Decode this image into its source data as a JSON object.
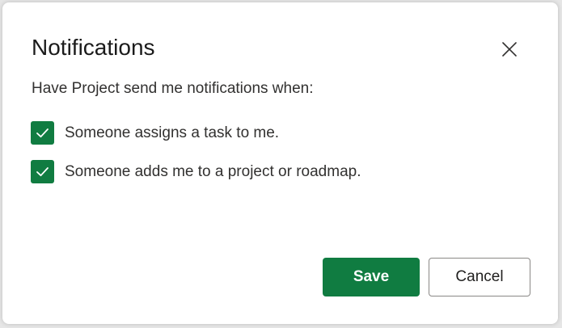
{
  "dialog": {
    "title": "Notifications",
    "subtitle": "Have Project send me notifications when:",
    "options": [
      {
        "label": "Someone assigns a task to me.",
        "checked": true
      },
      {
        "label": "Someone adds me to a project or roadmap.",
        "checked": true
      }
    ],
    "save_label": "Save",
    "cancel_label": "Cancel",
    "close_icon": "close-icon"
  },
  "colors": {
    "accent": "#107c41",
    "text": "#323130",
    "title": "#1b1b1b",
    "cancel_border": "#8a8886"
  }
}
